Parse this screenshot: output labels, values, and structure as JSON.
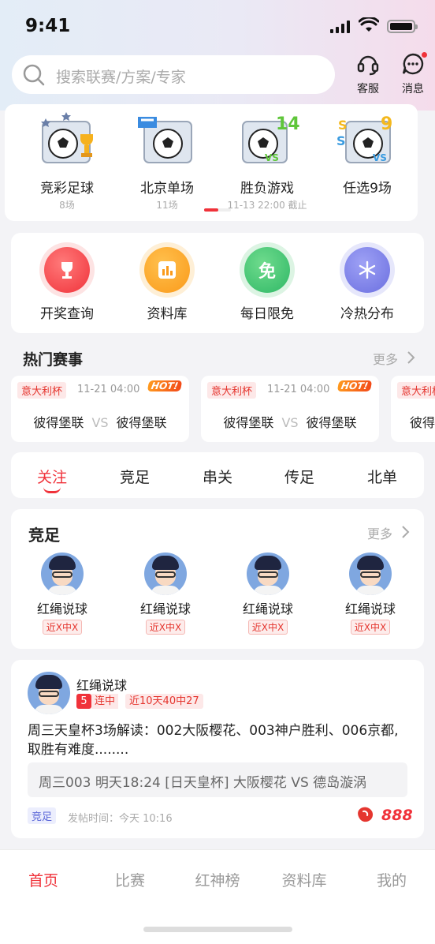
{
  "status_bar": {
    "time": "9:41"
  },
  "search": {
    "placeholder": "搜索联赛/方案/专家"
  },
  "header_actions": {
    "service": "客服",
    "messages": "消息"
  },
  "lotteries": [
    {
      "name": "竞彩足球",
      "sub": "8场"
    },
    {
      "name": "北京单场",
      "sub": "11场"
    },
    {
      "name": "胜负游戏",
      "sub": "11-13 22:00 截止"
    },
    {
      "name": "任选9场",
      "sub": ""
    }
  ],
  "tools": [
    {
      "name": "开奖查询",
      "icon": "trophy-icon",
      "color": "#f0323a"
    },
    {
      "name": "资料库",
      "icon": "chart-icon",
      "color": "#fa9a1a"
    },
    {
      "name": "每日限免",
      "icon": "免",
      "color": "#2fb866"
    },
    {
      "name": "冷热分布",
      "icon": "snowflake-icon",
      "color": "#6b6fe0"
    }
  ],
  "hot_matches": {
    "title": "热门赛事",
    "more": "更多",
    "items": [
      {
        "league": "意大利杯",
        "date": "11-21 04:00",
        "hot": "HOT!",
        "home": "彼得堡联",
        "vs": "VS",
        "away": "彼得堡联"
      },
      {
        "league": "意大利杯",
        "date": "11-21 04:00",
        "hot": "HOT!",
        "home": "彼得堡联",
        "vs": "VS",
        "away": "彼得堡联"
      },
      {
        "league": "意大利杯",
        "date": "",
        "hot": "",
        "home": "彼得",
        "vs": "",
        "away": ""
      }
    ]
  },
  "category_tabs": [
    "关注",
    "竞足",
    "串关",
    "传足",
    "北单"
  ],
  "experts": {
    "title": "竞足",
    "more": "更多",
    "items": [
      {
        "name": "红绳说球",
        "badge": "近X中X"
      },
      {
        "name": "红绳说球",
        "badge": "近X中X"
      },
      {
        "name": "红绳说球",
        "badge": "近X中X"
      },
      {
        "name": "红绳说球",
        "badge": "近X中X"
      }
    ]
  },
  "post": {
    "author": "红绳说球",
    "streak_num": "5",
    "streak_label": "连中",
    "record": "近10天40中27",
    "text": "周三天皇杯3场解读：002大阪樱花、003神户胜利、006京都,取胜有难度........",
    "match_info": "周三003 明天18:24 [日天皇杯] 大阪樱花 VS 德岛漩涡",
    "tag": "竞足",
    "time": "发帖时间：今天 10:16",
    "count": "888"
  },
  "bottom_nav": [
    "首页",
    "比赛",
    "红神榜",
    "资料库",
    "我的"
  ]
}
